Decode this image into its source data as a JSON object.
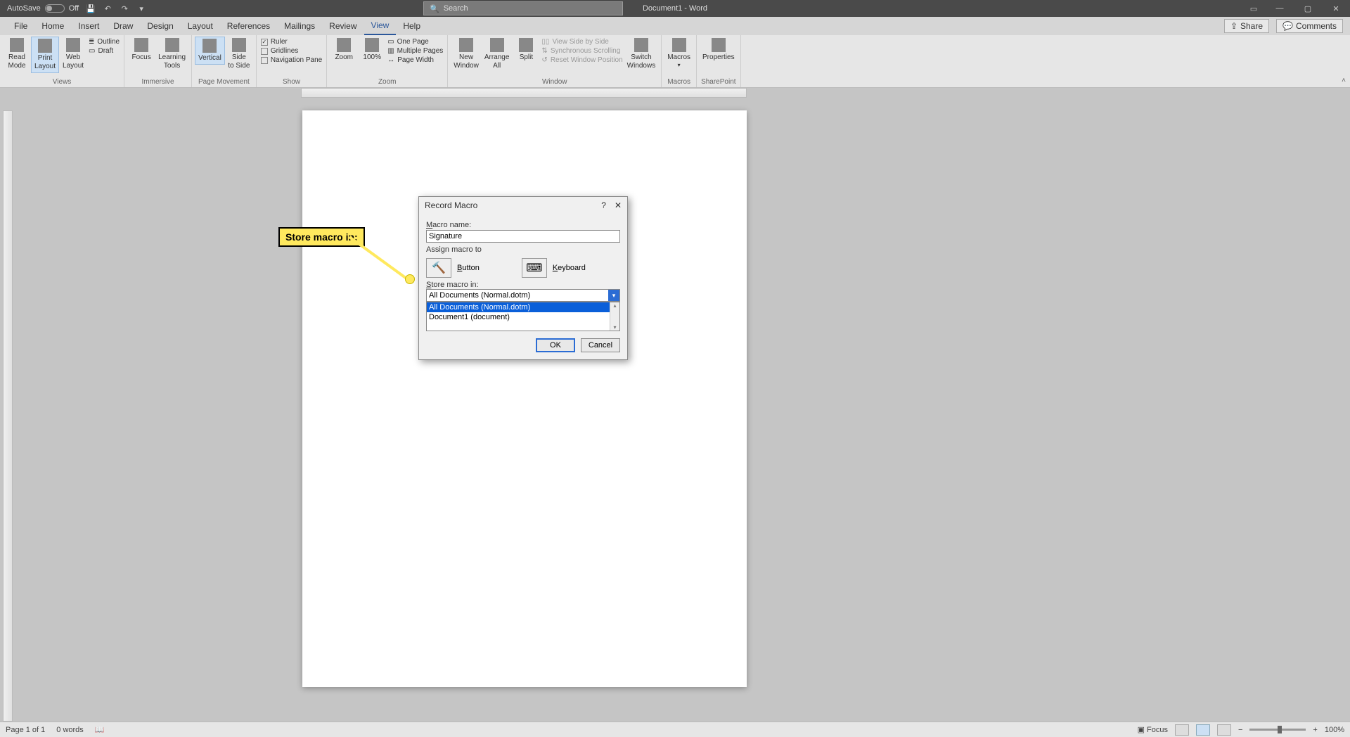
{
  "titlebar": {
    "autosave_label": "AutoSave",
    "autosave_state": "Off",
    "doc_title": "Document1 - Word",
    "search_placeholder": "Search"
  },
  "tabs": {
    "items": [
      "File",
      "Home",
      "Insert",
      "Draw",
      "Design",
      "Layout",
      "References",
      "Mailings",
      "Review",
      "View",
      "Help"
    ],
    "active_index": 9,
    "share_label": "Share",
    "comments_label": "Comments"
  },
  "ribbon": {
    "views": {
      "read_mode": "Read\nMode",
      "print_layout": "Print\nLayout",
      "web_layout": "Web\nLayout",
      "outline": "Outline",
      "draft": "Draft",
      "group_label": "Views"
    },
    "immersive": {
      "focus": "Focus",
      "learning_tools": "Learning\nTools",
      "group_label": "Immersive"
    },
    "page_movement": {
      "vertical": "Vertical",
      "side_to_side": "Side\nto Side",
      "group_label": "Page Movement"
    },
    "show": {
      "ruler": "Ruler",
      "gridlines": "Gridlines",
      "nav_pane": "Navigation Pane",
      "group_label": "Show"
    },
    "zoom": {
      "zoom": "Zoom",
      "hundred": "100%",
      "one_page": "One Page",
      "multiple_pages": "Multiple Pages",
      "page_width": "Page Width",
      "group_label": "Zoom"
    },
    "window": {
      "new_window": "New\nWindow",
      "arrange_all": "Arrange\nAll",
      "split": "Split",
      "view_side": "View Side by Side",
      "sync_scroll": "Synchronous Scrolling",
      "reset_pos": "Reset Window Position",
      "switch_windows": "Switch\nWindows",
      "group_label": "Window"
    },
    "macros": {
      "macros": "Macros",
      "group_label": "Macros"
    },
    "sharepoint": {
      "properties": "Properties",
      "group_label": "SharePoint"
    }
  },
  "callout": {
    "text": "Store macro in:"
  },
  "dialog": {
    "title": "Record Macro",
    "macro_name_label": "Macro name:",
    "macro_name_value": "Signature",
    "assign_label": "Assign macro to",
    "button_label": "Button",
    "keyboard_label": "Keyboard",
    "store_label": "Store macro in:",
    "store_selected": "All Documents (Normal.dotm)",
    "store_options": [
      "All Documents (Normal.dotm)",
      "Document1 (document)"
    ],
    "selected_index": 0,
    "ok_label": "OK",
    "cancel_label": "Cancel"
  },
  "statusbar": {
    "page_info": "Page 1 of 1",
    "word_count": "0 words",
    "focus_label": "Focus",
    "zoom_value": "100%"
  }
}
